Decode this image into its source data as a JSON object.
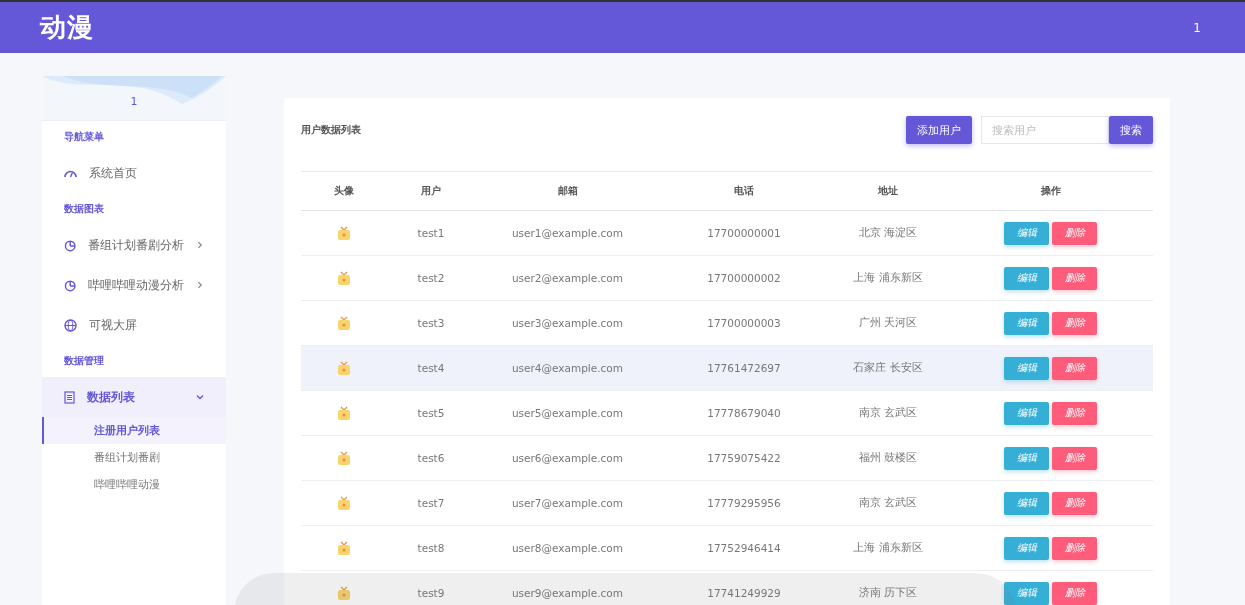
{
  "header": {
    "logo": "动漫",
    "user": "1"
  },
  "sidebar": {
    "profile_name": "1",
    "sections": [
      {
        "title": "导航菜单",
        "items": [
          {
            "label": "系统首页",
            "has_submenu": false,
            "expanded": false,
            "selected": false
          }
        ]
      },
      {
        "title": "数据图表",
        "items": [
          {
            "label": "番组计划番剧分析",
            "has_submenu": true,
            "expanded": false,
            "selected": false
          },
          {
            "label": "哔哩哔哩动漫分析",
            "has_submenu": true,
            "expanded": false,
            "selected": false
          },
          {
            "label": "可视大屏",
            "has_submenu": false,
            "expanded": false,
            "selected": false
          }
        ]
      },
      {
        "title": "数据管理",
        "items": [
          {
            "label": "数据列表",
            "has_submenu": true,
            "expanded": true,
            "selected": true,
            "children": [
              {
                "label": "注册用户列表",
                "selected": true
              },
              {
                "label": "番组计划番剧",
                "selected": false
              },
              {
                "label": "哔哩哔哩动漫",
                "selected": false
              }
            ]
          }
        ]
      }
    ]
  },
  "panel": {
    "title": "用户数据列表",
    "add_button": "添加用户",
    "search": {
      "placeholder": "搜索用户",
      "button": "搜索"
    },
    "table": {
      "columns": [
        "头像",
        "用户",
        "邮箱",
        "电话",
        "地址",
        "操作"
      ],
      "rows": [
        {
          "user": "test1",
          "email": "user1@example.com",
          "phone": "17700000001",
          "address": "北京 海淀区",
          "edit": "编辑",
          "delete": "删除",
          "highlighted": false
        },
        {
          "user": "test2",
          "email": "user2@example.com",
          "phone": "17700000002",
          "address": "上海 浦东新区",
          "edit": "编辑",
          "delete": "删除",
          "highlighted": false
        },
        {
          "user": "test3",
          "email": "user3@example.com",
          "phone": "17700000003",
          "address": "广州 天河区",
          "edit": "编辑",
          "delete": "删除",
          "highlighted": false
        },
        {
          "user": "test4",
          "email": "user4@example.com",
          "phone": "17761472697",
          "address": "石家庄 长安区",
          "edit": "编辑",
          "delete": "删除",
          "highlighted": true
        },
        {
          "user": "test5",
          "email": "user5@example.com",
          "phone": "17778679040",
          "address": "南京 玄武区",
          "edit": "编辑",
          "delete": "删除",
          "highlighted": false
        },
        {
          "user": "test6",
          "email": "user6@example.com",
          "phone": "17759075422",
          "address": "福州 鼓楼区",
          "edit": "编辑",
          "delete": "删除",
          "highlighted": false
        },
        {
          "user": "test7",
          "email": "user7@example.com",
          "phone": "17779295956",
          "address": "南京 玄武区",
          "edit": "编辑",
          "delete": "删除",
          "highlighted": false
        },
        {
          "user": "test8",
          "email": "user8@example.com",
          "phone": "17752946414",
          "address": "上海 浦东新区",
          "edit": "编辑",
          "delete": "删除",
          "highlighted": false
        },
        {
          "user": "test9",
          "email": "user9@example.com",
          "phone": "17741249929",
          "address": "济南 历下区",
          "edit": "编辑",
          "delete": "删除",
          "highlighted": false
        }
      ]
    }
  }
}
